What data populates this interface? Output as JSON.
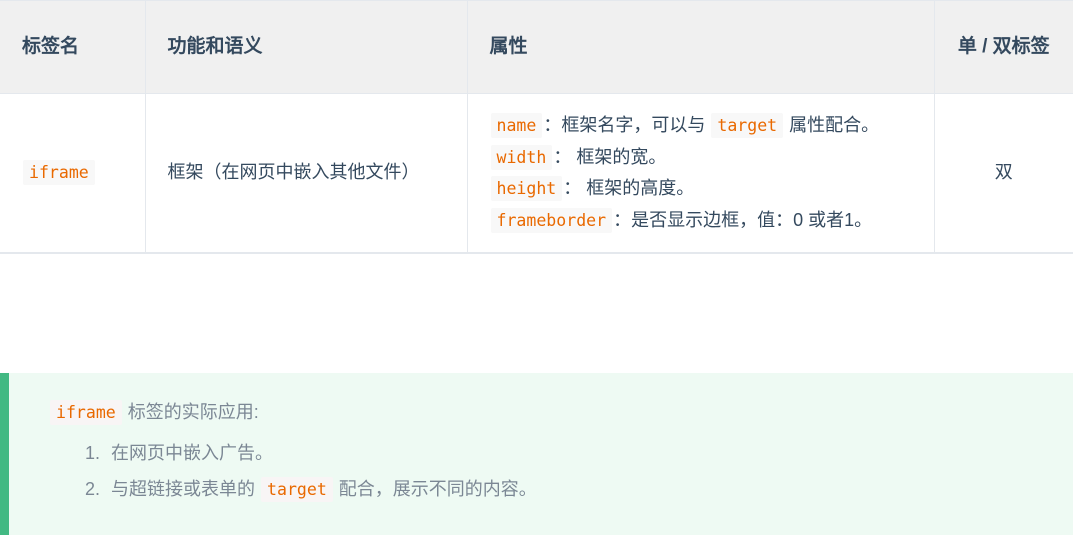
{
  "table": {
    "headers": [
      {
        "label": "标签名",
        "align": "left"
      },
      {
        "label": "功能和语义",
        "align": "left"
      },
      {
        "label": "属性",
        "align": "left"
      },
      {
        "label": "单 / 双标签",
        "align": "center"
      }
    ],
    "rows": [
      {
        "tag_name": "iframe",
        "semantics": "框架（在网页中嵌入其他文件）",
        "attributes": [
          {
            "code": "name",
            "sep": "：",
            "text_before": "框架名字，可以与 ",
            "inline_code": "target",
            "text_after": " 属性配合。"
          },
          {
            "code": "width",
            "sep": "：",
            "text_before": " 框架的宽。",
            "inline_code": "",
            "text_after": ""
          },
          {
            "code": "height",
            "sep": "：",
            "text_before": " 框架的高度。",
            "inline_code": "",
            "text_after": ""
          },
          {
            "code": "frameborder",
            "sep": "：",
            "text_before": "是否显示边框，值：0 或者1。",
            "inline_code": "",
            "text_after": ""
          }
        ],
        "single_or_double": "双"
      }
    ]
  },
  "callout": {
    "title_code": "iframe",
    "title_text": " 标签的实际应用:",
    "items": [
      {
        "text_before": "在网页中嵌入广告。",
        "inline_code": "",
        "text_after": ""
      },
      {
        "text_before": "与超链接或表单的 ",
        "inline_code": "target",
        "text_after": " 配合，展示不同的内容。"
      }
    ]
  },
  "colors": {
    "header_bg": "#f0f0f0",
    "header_text": "#34495e",
    "border": "#e4e8ed",
    "code_text": "#e96900",
    "code_bg": "#f8f8f8",
    "callout_bg": "#eefaf3",
    "callout_accent": "#42b983",
    "callout_text": "#7b8794"
  }
}
